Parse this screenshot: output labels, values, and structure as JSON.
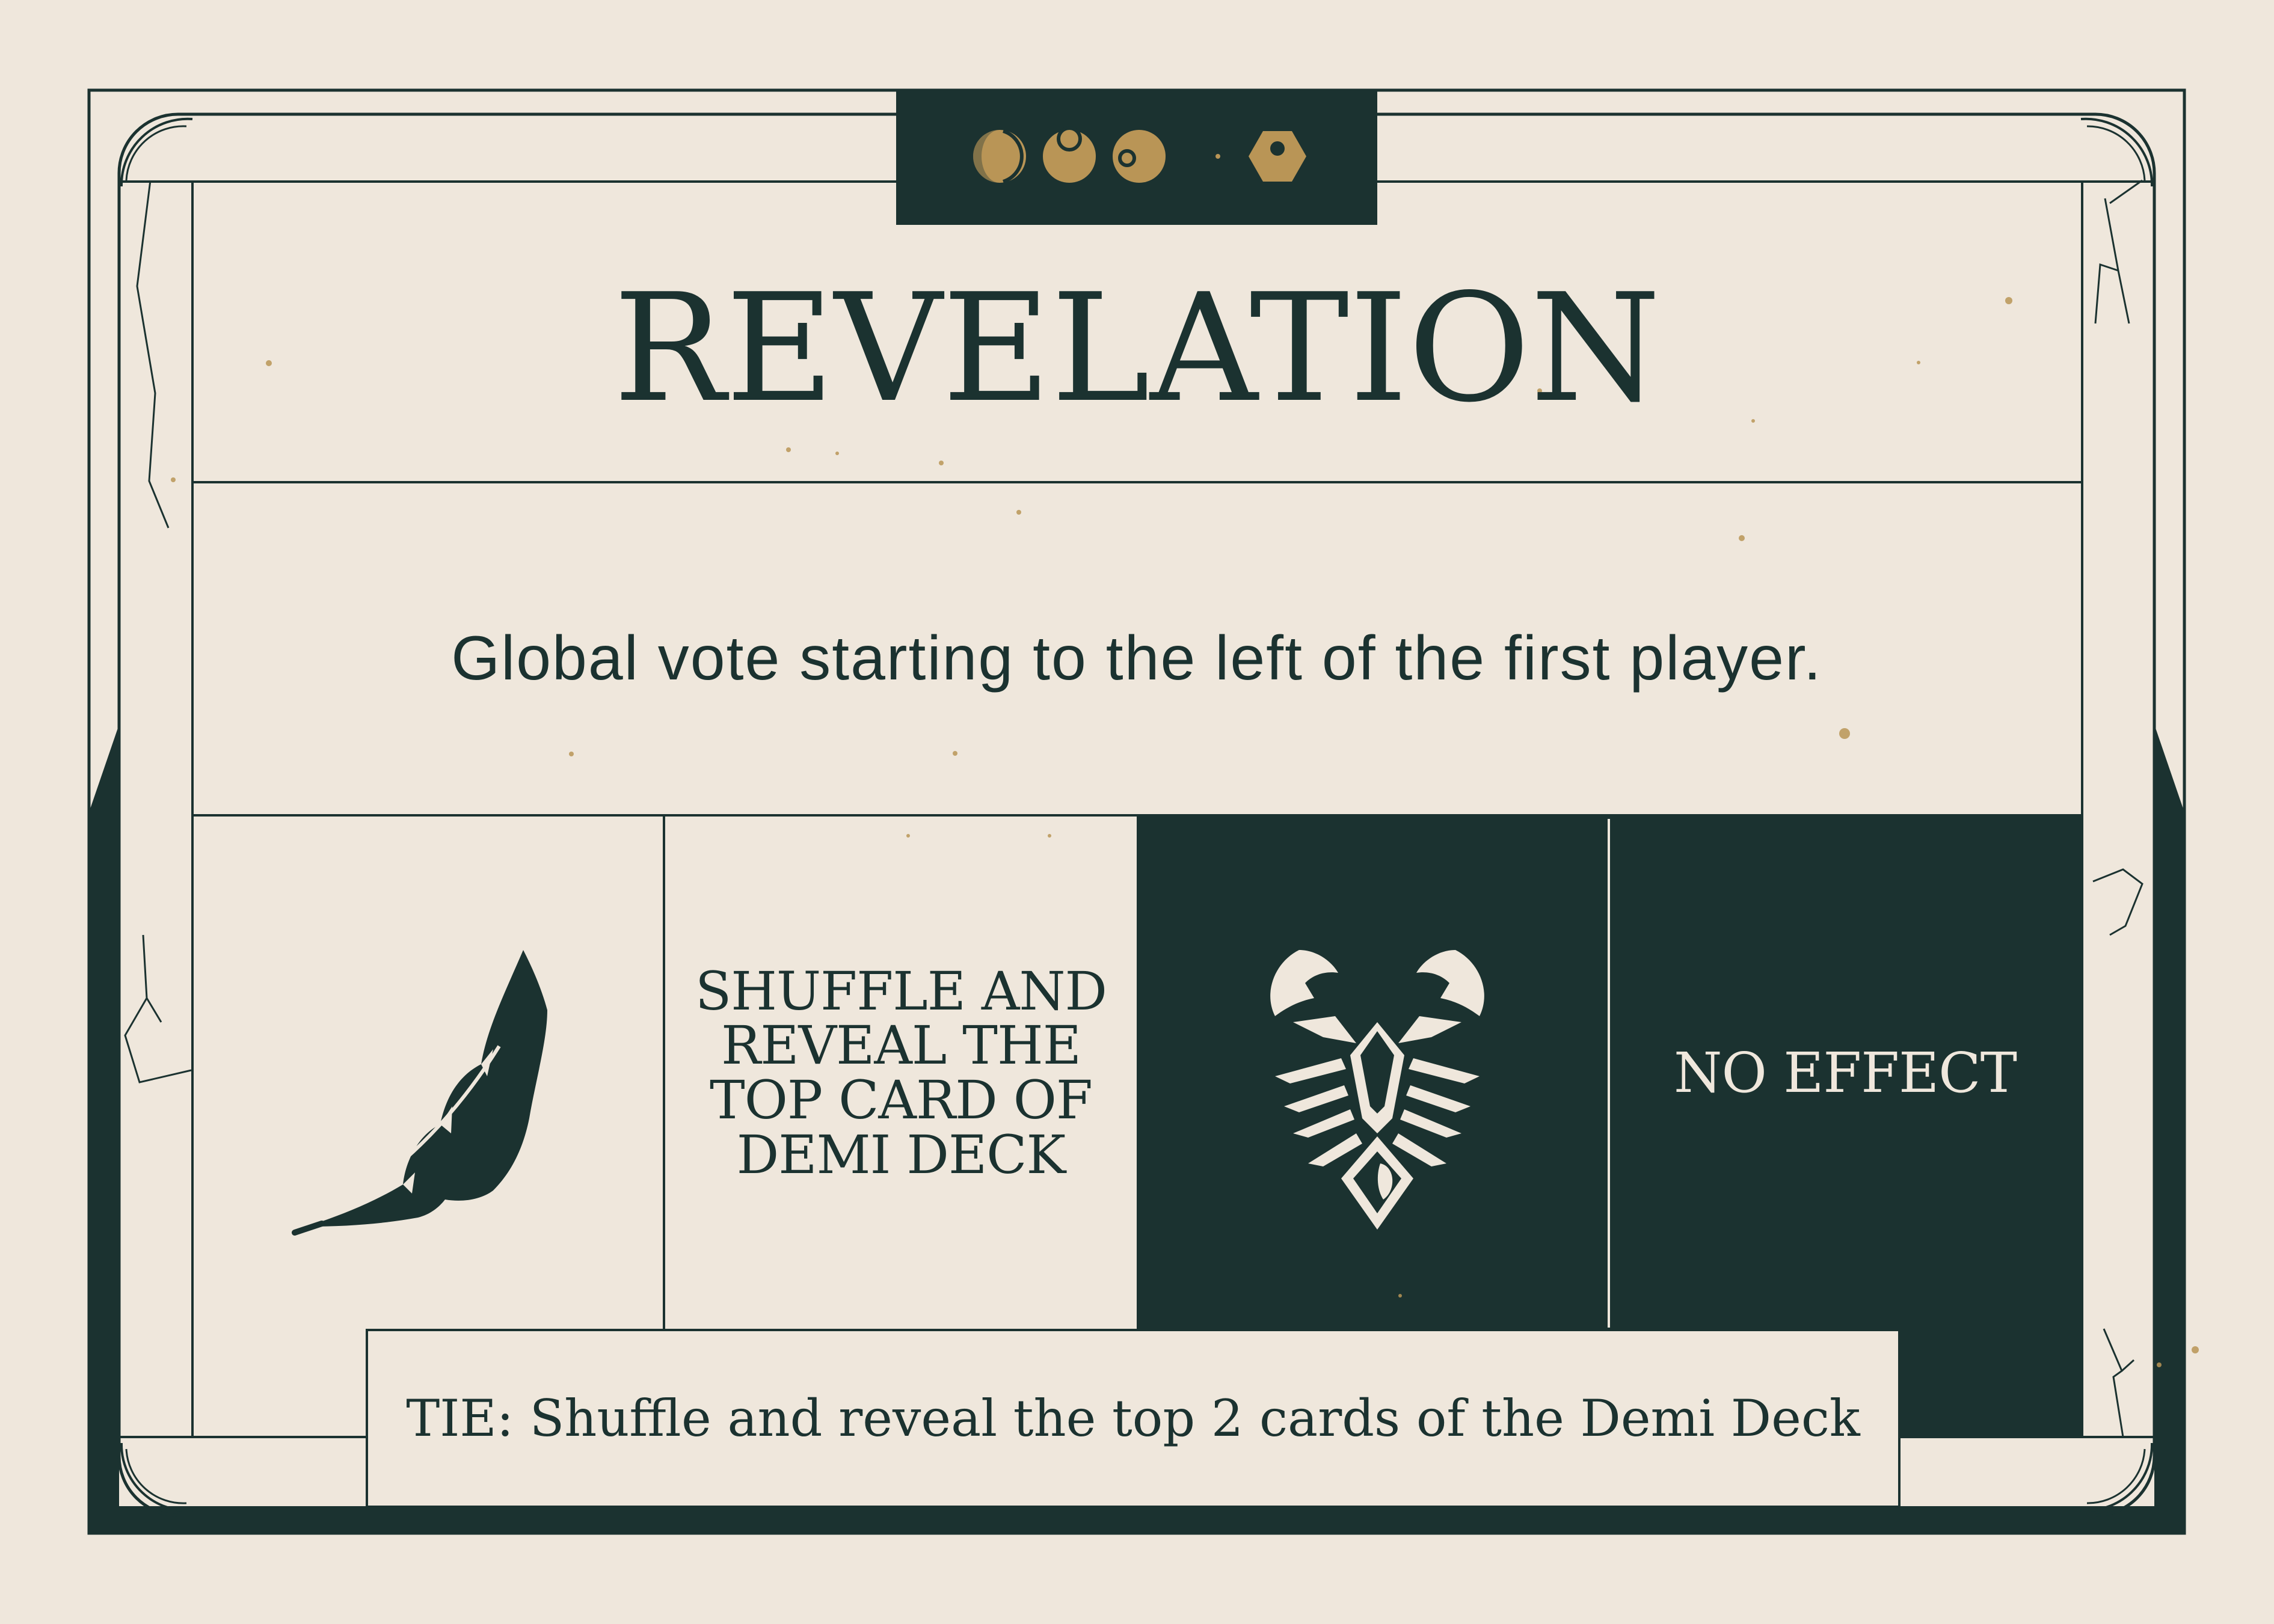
{
  "card": {
    "title": "REVELATION",
    "rule": "Global vote starting to the left of the first player.",
    "effects": [
      {
        "label": "SHUFFLE AND REVEAL THE TOP CARD OF DEMI DECK",
        "icon": "feather-icon"
      },
      {
        "label": "NO EFFECT",
        "icon": "scorpion-icon"
      }
    ],
    "tie": "TIE: Shuffle and reveal the top 2 cards of the Demi Deck"
  },
  "header_icons": [
    "waxing-moon-icon",
    "moon-phase-icon",
    "full-moon-icon",
    "hexagon-token-icon"
  ],
  "colors": {
    "background": "#efe7dc",
    "dark_green": "#1b3230",
    "gold": "#b99556"
  }
}
